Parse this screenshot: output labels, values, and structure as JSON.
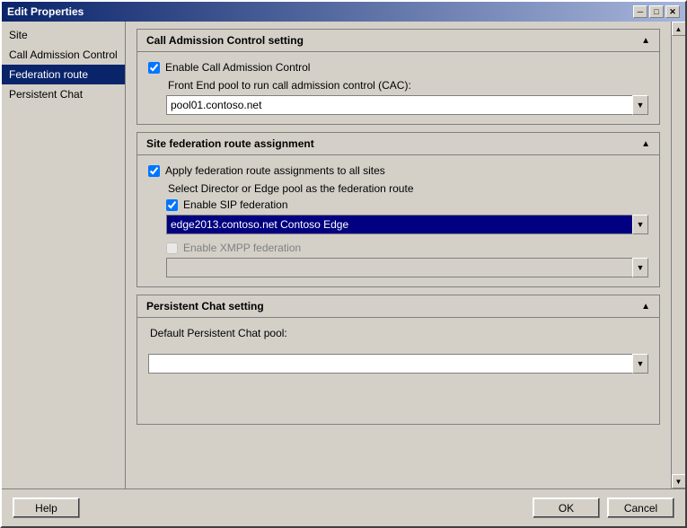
{
  "window": {
    "title": "Edit Properties",
    "title_icon": "edit-icon"
  },
  "title_buttons": {
    "minimize": "─",
    "maximize": "□",
    "close": "✕"
  },
  "sidebar": {
    "items": [
      {
        "id": "site",
        "label": "Site",
        "active": false
      },
      {
        "id": "call-admission-control",
        "label": "Call Admission Control",
        "active": false
      },
      {
        "id": "federation-route",
        "label": "Federation route",
        "active": true
      },
      {
        "id": "persistent-chat",
        "label": "Persistent Chat",
        "active": false
      }
    ]
  },
  "sections": {
    "cac": {
      "header": "Call Admission Control setting",
      "enable_label": "Enable Call Admission Control",
      "enable_checked": true,
      "front_end_label": "Front End pool to run call admission control (CAC):",
      "front_end_value": "pool01.contoso.net"
    },
    "federation": {
      "header": "Site federation route assignment",
      "apply_label": "Apply federation route assignments to all sites",
      "apply_checked": true,
      "select_label": "Select Director or Edge pool as the federation route",
      "sip_label": "Enable SIP federation",
      "sip_checked": true,
      "sip_value": "edge2013.contoso.net    Contoso    Edge",
      "xmpp_label": "Enable XMPP federation",
      "xmpp_checked": false,
      "xmpp_disabled": true,
      "xmpp_value": ""
    },
    "persistent_chat": {
      "header": "Persistent Chat setting",
      "pool_label": "Default Persistent Chat pool:",
      "pool_value": ""
    }
  },
  "footer": {
    "help_label": "Help",
    "ok_label": "OK",
    "cancel_label": "Cancel"
  }
}
